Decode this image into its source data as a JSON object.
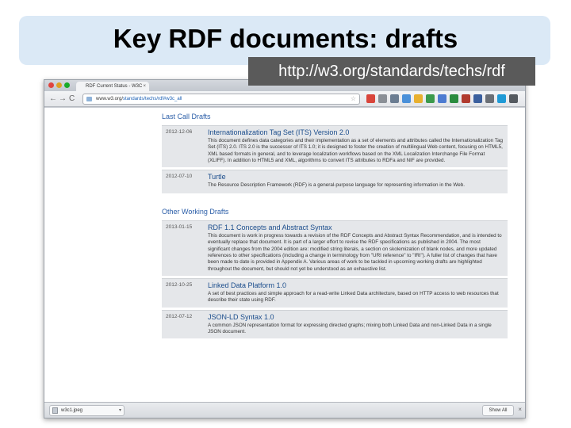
{
  "slide": {
    "title": "Key RDF documents: drafts",
    "url_label": "http://w3.org/standards/techs/rdf"
  },
  "browser": {
    "tab_title": "RDF Current Status - W3C",
    "tab_close": "×",
    "address": {
      "host": "www.w3.org/",
      "path": "standards/techs/rdf#w3c_all"
    },
    "nav": {
      "back": "←",
      "forward": "→",
      "reload": "C"
    },
    "star": "☆",
    "extension_colors": [
      "#d9453b",
      "#8a8f96",
      "#6b7d92",
      "#4a90d9",
      "#e8b02f",
      "#3b9a4c",
      "#4c7bd1",
      "#2a8c3f",
      "#b03a2e",
      "#3a5f9e",
      "#6a6f76",
      "#1f9ad6",
      "#555a60"
    ]
  },
  "page": {
    "sections": [
      {
        "heading": "Last Call Drafts",
        "documents": [
          {
            "date": "2012-12-06",
            "title": "Internationalization Tag Set (ITS) Version 2.0",
            "description": "This document defines data categories and their implementation as a set of elements and attributes called the Internationalization Tag Set (ITS) 2.0. ITS 2.0 is the successor of ITS 1.0; it is designed to foster the creation of multilingual Web content, focusing on HTML5, XML based formats in general, and to leverage localization workflows based on the XML Localization Interchange File Format (XLIFF). In addition to HTML5 and XML, algorithms to convert ITS attributes to RDFa and NIF are provided."
          },
          {
            "date": "2012-07-10",
            "title": "Turtle",
            "description": "The Resource Description Framework (RDF) is a general-purpose language for representing information in the Web."
          }
        ]
      },
      {
        "heading": "Other Working Drafts",
        "documents": [
          {
            "date": "2013-01-15",
            "title": "RDF 1.1 Concepts and Abstract Syntax",
            "description": "This document is work in progress towards a revision of the RDF Concepts and Abstract Syntax Recommendation, and is intended to eventually replace that document. It is part of a larger effort to revise the RDF specifications as published in 2004. The most significant changes from the 2004 edition are: modified string literals, a section on skolemization of blank nodes, and more updated references to other specifications (including a change in terminology from \"URI reference\" to \"IRI\"). A fuller list of changes that have been made to date is provided in Appendix A. Various areas of work to be tackled in upcoming working drafts are highlighted throughout the document, but should not yet be understood as an exhaustive list."
          },
          {
            "date": "2012-10-25",
            "title": "Linked Data Platform 1.0",
            "description": "A set of best practices and simple approach for a read-write Linked Data architecture, based on HTTP access to web resources that describe their state using RDF."
          },
          {
            "date": "2012-07-12",
            "title": "JSON-LD Syntax 1.0",
            "description": "A common JSON representation format for expressing directed graphs; mixing both Linked Data and non-Linked Data in a single JSON document."
          }
        ]
      }
    ]
  },
  "downloads": {
    "file_name": "w3c1.jpeg",
    "menu": "▾",
    "show_all": "Show All",
    "close": "×"
  }
}
